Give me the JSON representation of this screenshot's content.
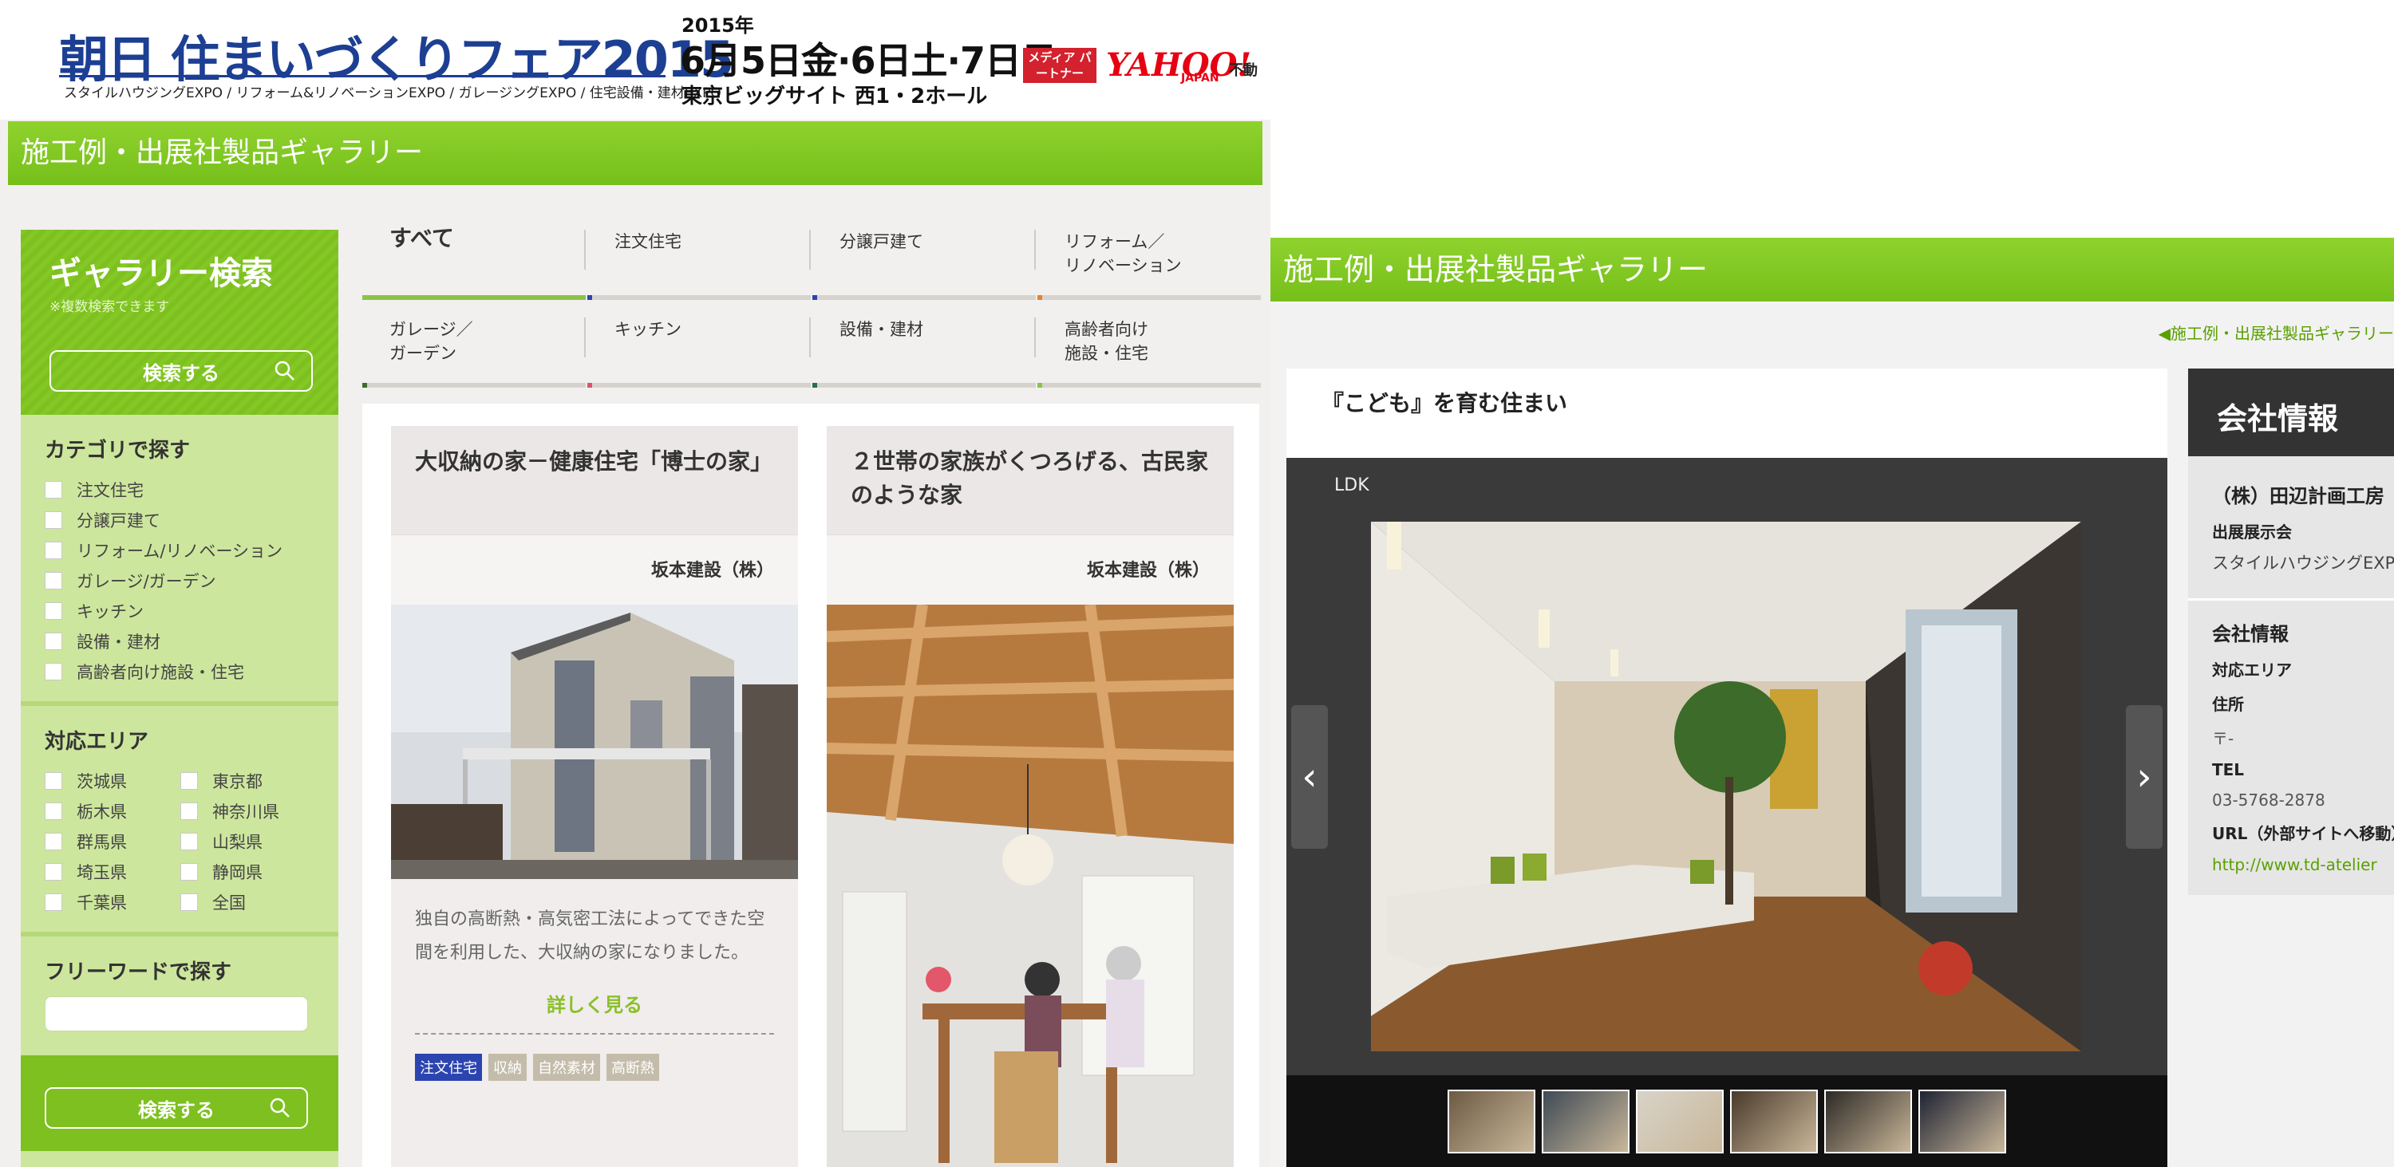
{
  "banner": {
    "title": "朝日 住まいづくりフェア2015",
    "subtitle": "スタイルハウジングEXPO / リフォーム&リノベーションEXPO / ガレージングEXPO / 住宅設備・建材EXPO",
    "year": "2015年",
    "dates": "6月5日金·6日土·7日日",
    "venue": "東京ビッグサイト 西1・2ホール",
    "media_badge": "メディア パートナー",
    "yahoo": "YAHOO!",
    "yahoo_sub": "JAPAN",
    "fudosan": "不動"
  },
  "left_title": "施工例・出展社製品ギャラリー",
  "sidebar": {
    "heading": "ギャラリー検索",
    "note": "※複数検索できます",
    "search_label": "検索する",
    "category_heading": "カテゴリで探す",
    "categories": [
      "注文住宅",
      "分譲戸建て",
      "リフォーム/リノベーション",
      "ガレージ/ガーデン",
      "キッチン",
      "設備・建材",
      "高齢者向け施設・住宅"
    ],
    "area_heading": "対応エリア",
    "areas": [
      "茨城県",
      "東京都",
      "栃木県",
      "神奈川県",
      "群馬県",
      "山梨県",
      "埼玉県",
      "静岡県",
      "千葉県",
      "全国"
    ],
    "freeword_heading": "フリーワードで探す",
    "freeword_value": "",
    "search_label_bottom": "検索する"
  },
  "tabs": [
    {
      "label": "すべて",
      "color": "#8bc34a"
    },
    {
      "label": "注文住宅",
      "color": "#2b44b0"
    },
    {
      "label": "分譲戸建て",
      "color": "#2b44b0"
    },
    {
      "label": "リフォーム／\nリノベーション",
      "color": "#e8802a"
    },
    {
      "label": "ガレージ／\nガーデン",
      "color": "#3a6e2a"
    },
    {
      "label": "キッチン",
      "color": "#e0506c"
    },
    {
      "label": "設備・建材",
      "color": "#2a6e4a"
    },
    {
      "label": "高齢者向け\n施設・住宅",
      "color": "#8bc34a"
    }
  ],
  "cards": [
    {
      "title": "大収納の家－健康住宅「博士の家」",
      "company": "坂本建設（株）",
      "description": "独自の高断熱・高気密工法によってできた空間を利用した、大収納の家になりました。",
      "more": "詳しく見る",
      "tags": [
        "注文住宅",
        "収納",
        "自然素材",
        "高断熱"
      ]
    },
    {
      "title": "２世帯の家族がくつろげる、古民家のような家",
      "company": "坂本建設（株）"
    }
  ],
  "right": {
    "title": "施工例・出展社製品ギャラリー",
    "breadcrumb": "◀施工例・出展社製品ギャラリー",
    "gallery_title": "『こども』を育む住まい",
    "photo_caption": "LDK",
    "prev": "‹",
    "next": "›",
    "thumb_count": 6
  },
  "company": {
    "heading": "会社情報",
    "name": "（株）田辺計画工房",
    "exhibit_label": "出展展示会",
    "exhibit_value": "スタイルハウジングEXPO",
    "info_heading": "会社情報",
    "area_label": "対応エリア",
    "address_label": "住所",
    "postal": "〒-",
    "tel_label": "TEL",
    "tel": "03-5768-2878",
    "url_label": "URL（外部サイトへ移動）",
    "url": "http://www.td-atelier"
  }
}
